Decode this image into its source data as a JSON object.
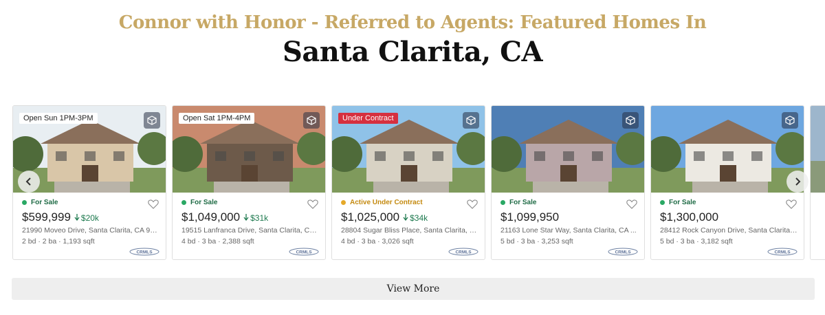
{
  "header": {
    "subtitle": "Connor with Honor - Referred to Agents: Featured Homes In",
    "title": "Santa Clarita, CA",
    "subtitle_color": "#c7a865"
  },
  "listings": [
    {
      "tag": "Open Sun 1PM-3PM",
      "tag_style": "white",
      "status": "For Sale",
      "status_color": "#2aa864",
      "price": "$599,999",
      "price_drop": "$20k",
      "address": "21990 Moveo Drive, Santa Clarita, CA 91...",
      "details": "2 bd · 2 ba · 1,193 sqft",
      "mls": "CRMLS",
      "photo": {
        "sky": "#e8eef2",
        "house": "#d9c6a8"
      }
    },
    {
      "tag": "Open Sat 1PM-4PM",
      "tag_style": "white",
      "status": "For Sale",
      "status_color": "#2aa864",
      "price": "$1,049,000",
      "price_drop": "$31k",
      "address": "19515 Lanfranca Drive, Santa Clarita, CA...",
      "details": "4 bd · 3 ba · 2,388 sqft",
      "mls": "CRMLS",
      "photo": {
        "sky": "#c98a6e",
        "house": "#6d5a4a"
      }
    },
    {
      "tag": "Under Contract",
      "tag_style": "red",
      "status": "Active Under Contract",
      "status_color": "#e5a92a",
      "price": "$1,025,000",
      "price_drop": "$34k",
      "address": "28804 Sugar Bliss Place, Santa Clarita, C...",
      "details": "4 bd · 3 ba · 3,026 sqft",
      "mls": "CRMLS",
      "photo": {
        "sky": "#8fc2e8",
        "house": "#d8d2c4"
      }
    },
    {
      "tag": "",
      "tag_style": "none",
      "status": "For Sale",
      "status_color": "#2aa864",
      "price": "$1,099,950",
      "price_drop": "",
      "address": "21163 Lone Star Way, Santa Clarita, CA ...",
      "details": "5 bd · 3 ba · 3,253 sqft",
      "mls": "CRMLS",
      "photo": {
        "sky": "#4f7fb5",
        "house": "#b9a6a8"
      }
    },
    {
      "tag": "",
      "tag_style": "none",
      "status": "For Sale",
      "status_color": "#2aa864",
      "price": "$1,300,000",
      "price_drop": "",
      "address": "28412 Rock Canyon Drive, Santa Clarita,...",
      "details": "5 bd · 3 ba · 3,182 sqft",
      "mls": "CRMLS",
      "photo": {
        "sky": "#6ea7e0",
        "house": "#ece9e2"
      }
    }
  ],
  "icons": {
    "tour": "3d-cube-icon",
    "favorite": "heart-icon",
    "prev": "chevron-left-icon",
    "next": "chevron-right-icon",
    "drop": "arrow-down-icon"
  },
  "view_more_label": "View More"
}
